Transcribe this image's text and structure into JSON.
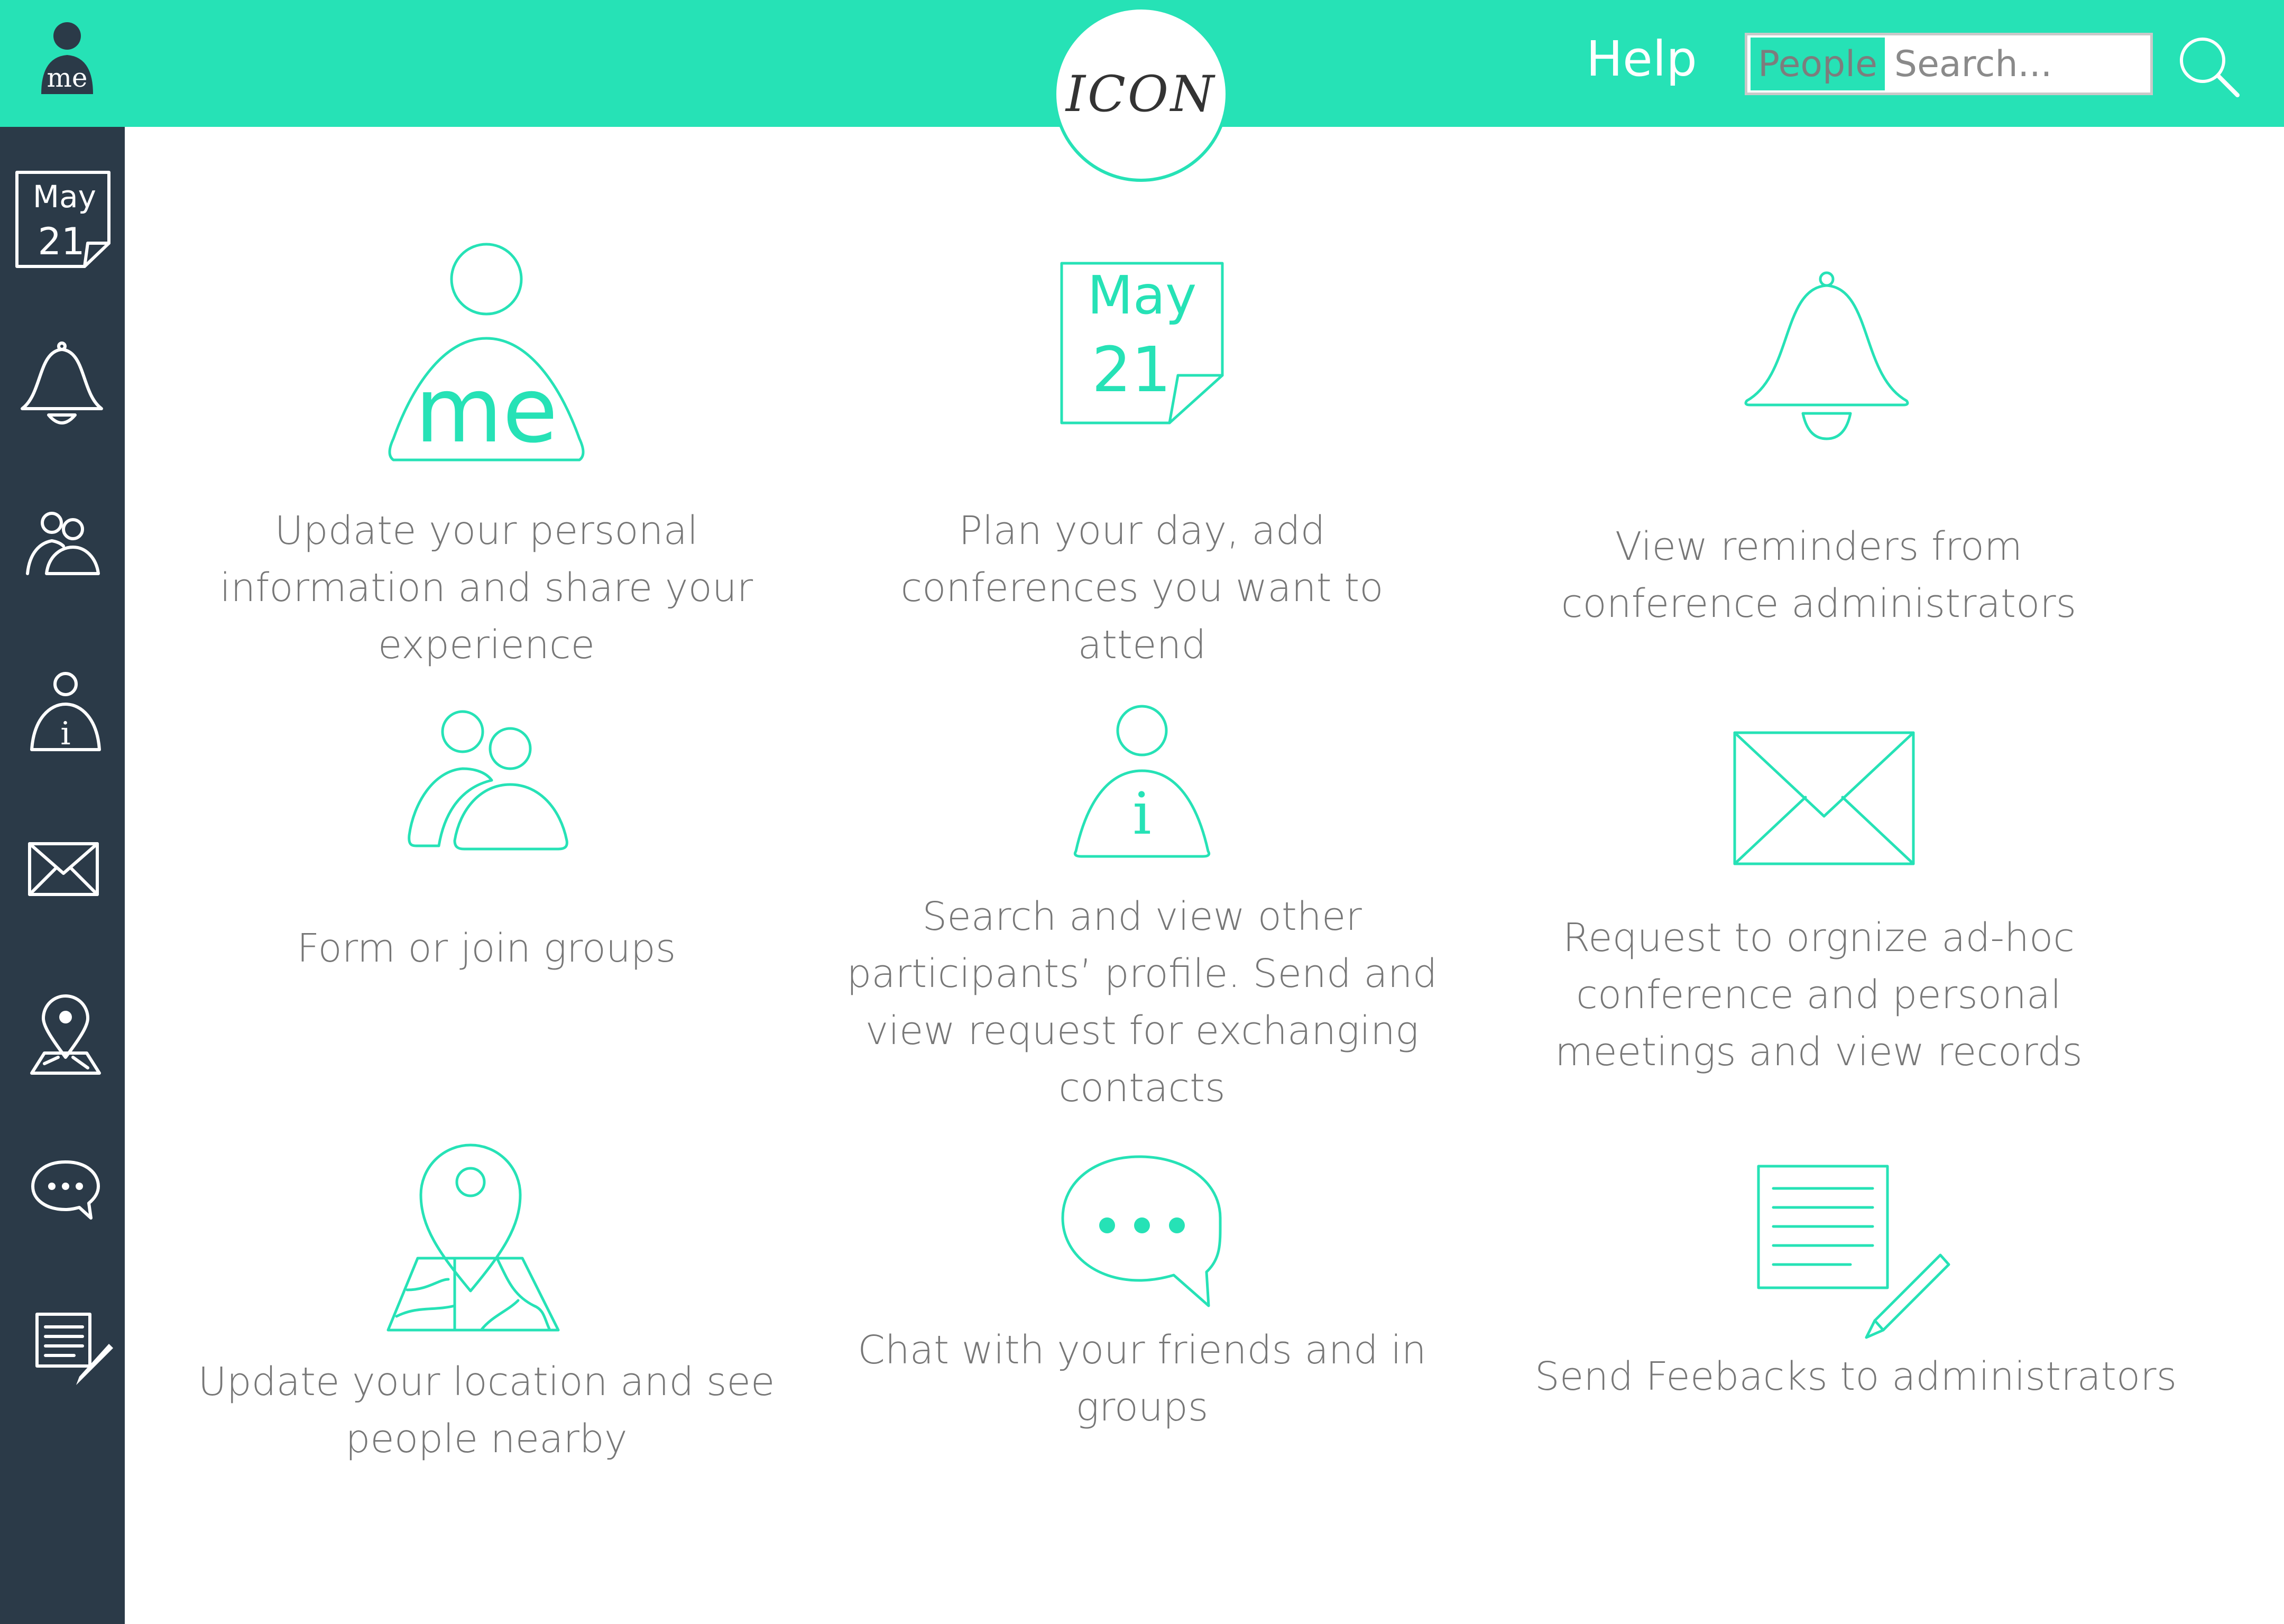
{
  "header": {
    "avatar_label": "me",
    "logo": "ICON",
    "help": "Help",
    "search": {
      "scope": "People",
      "placeholder": "Search..."
    }
  },
  "sidebar": {
    "calendar": {
      "month": "May",
      "day": "21"
    },
    "items": [
      {
        "icon": "calendar-icon"
      },
      {
        "icon": "bell-icon"
      },
      {
        "icon": "groups-icon"
      },
      {
        "icon": "info-person-icon"
      },
      {
        "icon": "mail-icon"
      },
      {
        "icon": "map-pin-icon"
      },
      {
        "icon": "chat-icon"
      },
      {
        "icon": "feedback-icon"
      }
    ]
  },
  "features": [
    {
      "icon": "profile-me-icon",
      "icon_text": "me",
      "label": "Update your personal information and share your experience"
    },
    {
      "icon": "calendar-icon",
      "month": "May",
      "day": "21",
      "label": "Plan your day, add conferences you want to attend"
    },
    {
      "icon": "bell-icon",
      "label": "View reminders from conference administrators"
    },
    {
      "icon": "groups-icon",
      "label": "Form or join groups"
    },
    {
      "icon": "info-person-icon",
      "icon_text": "i",
      "label": "Search and view other participants’ profile. Send and view request for exchanging contacts"
    },
    {
      "icon": "mail-icon",
      "label": "Request to orgnize ad-hoc conference and personal meetings and view records"
    },
    {
      "icon": "map-pin-icon",
      "label": "Update your location and see people nearby"
    },
    {
      "icon": "chat-icon",
      "label": "Chat with your friends and in groups"
    },
    {
      "icon": "feedback-icon",
      "label": "Send Feebacks to administrators"
    }
  ],
  "colors": {
    "accent": "#26e2b6",
    "sidebar": "#2b3a48",
    "text": "#777777"
  }
}
